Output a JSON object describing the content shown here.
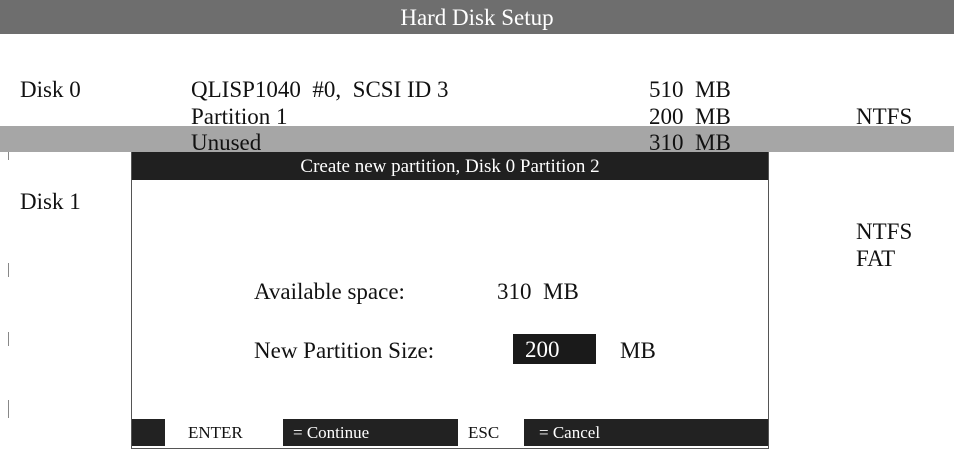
{
  "window": {
    "title": "Hard Disk Setup"
  },
  "disks": [
    {
      "label": "Disk 0",
      "info": "QLISP1040  #0,  SCSI ID 3",
      "size": "510  MB",
      "partitions": [
        {
          "name": "Partition 1",
          "size": "200  MB",
          "fs": "NTFS"
        },
        {
          "name": "Unused",
          "size": "310  MB",
          "fs": ""
        }
      ]
    },
    {
      "label": "Disk 1",
      "fs_list": [
        "NTFS",
        "FAT"
      ]
    }
  ],
  "dialog": {
    "title": "Create new partition,  Disk  0  Partition 2",
    "available_label": "Available space:",
    "available_value": "310  MB",
    "size_label": "New Partition Size:",
    "size_value": "200",
    "size_unit": "MB"
  },
  "hints": [
    {
      "key": "ENTER",
      "action": "= Continue"
    },
    {
      "key": "ESC",
      "action": "= Cancel"
    }
  ]
}
